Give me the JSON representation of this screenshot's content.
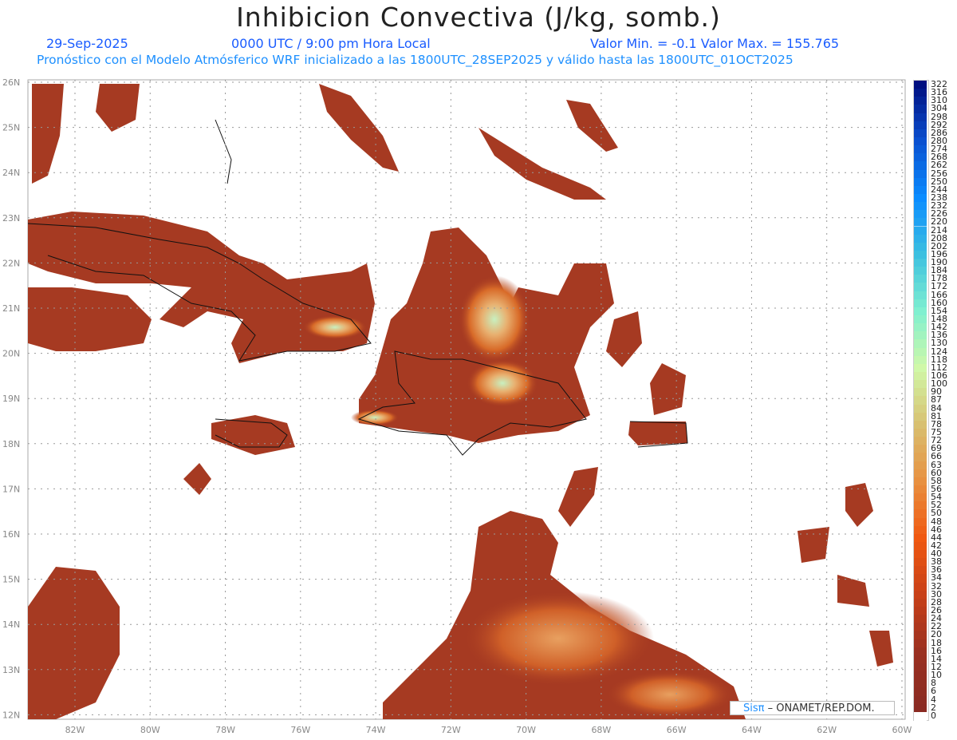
{
  "header": {
    "title": "Inhibicion Convectiva (J/kg, somb.)",
    "date": "29-Sep-2025",
    "time": "0000 UTC / 9:00 pm Hora Local",
    "minmax": "Valor Min. = -0.1  Valor Max. = 155.765",
    "model_info": "Pronóstico con el Modelo Atmósferico WRF inicializado a las 1800UTC_28SEP2025 y válido hasta las  1800UTC_01OCT2025"
  },
  "axes": {
    "lat_labels": [
      "26N",
      "25N",
      "24N",
      "23N",
      "22N",
      "21N",
      "20N",
      "19N",
      "18N",
      "17N",
      "16N",
      "15N",
      "14N",
      "13N",
      "12N"
    ],
    "lon_labels": [
      "82W",
      "80W",
      "78W",
      "76W",
      "74W",
      "72W",
      "70W",
      "68W",
      "66W",
      "64W",
      "62W",
      "60W"
    ]
  },
  "colorbar": {
    "labels": [
      "322",
      "316",
      "310",
      "304",
      "298",
      "292",
      "286",
      "280",
      "274",
      "268",
      "262",
      "256",
      "250",
      "244",
      "238",
      "232",
      "226",
      "220",
      "214",
      "208",
      "202",
      "196",
      "190",
      "184",
      "178",
      "172",
      "166",
      "160",
      "154",
      "148",
      "142",
      "136",
      "130",
      "124",
      "118",
      "112",
      "106",
      "100",
      "90",
      "87",
      "84",
      "81",
      "78",
      "75",
      "72",
      "69",
      "66",
      "63",
      "60",
      "58",
      "56",
      "54",
      "52",
      "50",
      "48",
      "46",
      "44",
      "42",
      "40",
      "38",
      "36",
      "34",
      "32",
      "30",
      "28",
      "26",
      "24",
      "22",
      "20",
      "18",
      "16",
      "14",
      "12",
      "10",
      "8",
      "6",
      "4",
      "2",
      "0"
    ],
    "anchor_colors": [
      "#000f80",
      "#0a50d0",
      "#0a8cff",
      "#3cc0e0",
      "#80f0d0",
      "#d0f8a8",
      "#d8c070",
      "#e89040",
      "#f05810",
      "#c84018",
      "#9a3020",
      "#8a2a22",
      "#ffffff"
    ],
    "accent": "#a63a22"
  },
  "credit": {
    "brand": "Sisπ",
    "text": " –  ONAMET/REP.DOM."
  }
}
